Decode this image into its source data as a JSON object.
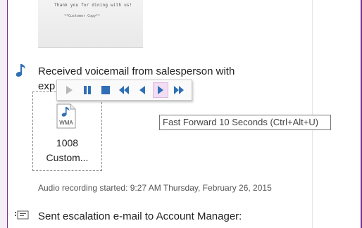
{
  "receipt": {
    "line1": "Thank you for dining with us!",
    "line2": "**Customer Copy**"
  },
  "note": {
    "title_line1": "Received voicemail from salesperson with",
    "title_line2": "exp"
  },
  "attachment": {
    "icon_label": "WMA",
    "name_line1": "1008",
    "name_line2": "Custom..."
  },
  "playback_toolbar": {
    "buttons": [
      {
        "name": "play",
        "state": "disabled"
      },
      {
        "name": "pause",
        "state": "enabled"
      },
      {
        "name": "stop",
        "state": "enabled"
      },
      {
        "name": "rewind",
        "state": "enabled"
      },
      {
        "name": "rewind-10s",
        "state": "enabled"
      },
      {
        "name": "fast-forward-10s",
        "state": "hovered"
      },
      {
        "name": "fast-forward",
        "state": "enabled"
      }
    ],
    "accent_color": "#2f6fb5"
  },
  "tooltip": {
    "text": "Fast Forward 10 Seconds (Ctrl+Alt+U)"
  },
  "recording": {
    "info": "Audio recording started: 9:27 AM Thursday, February 26, 2015"
  },
  "email_note": {
    "text": "Sent escalation e-mail to Account Manager:"
  },
  "colors": {
    "onenote_purple": "#7a2f8e",
    "button_blue": "#2f6fb5",
    "hover_bg": "#f2ddf4"
  }
}
